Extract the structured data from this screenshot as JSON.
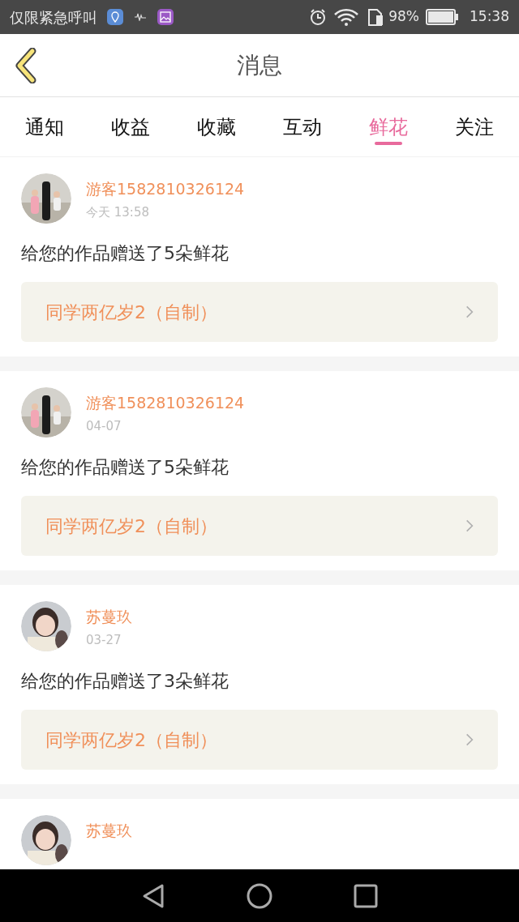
{
  "status_bar": {
    "notice": "仅限紧急呼叫",
    "battery": "98%",
    "time": "15:38"
  },
  "header": {
    "title": "消息"
  },
  "tabs": [
    {
      "label": "通知",
      "selected": false
    },
    {
      "label": "收益",
      "selected": false
    },
    {
      "label": "收藏",
      "selected": false
    },
    {
      "label": "互动",
      "selected": false
    },
    {
      "label": "鲜花",
      "selected": true
    },
    {
      "label": "关注",
      "selected": false
    }
  ],
  "messages": [
    {
      "name": "游客1582810326124",
      "time": "今天 13:58",
      "text": "给您的作品赠送了5朵鲜花",
      "work": "同学两亿岁2（自制）"
    },
    {
      "name": "游客1582810326124",
      "time": "04-07",
      "text": "给您的作品赠送了5朵鲜花",
      "work": "同学两亿岁2（自制）"
    },
    {
      "name": "苏蔓玖",
      "time": "03-27",
      "text": "给您的作品赠送了3朵鲜花",
      "work": "同学两亿岁2（自制）"
    },
    {
      "name": "苏蔓玖"
    }
  ]
}
